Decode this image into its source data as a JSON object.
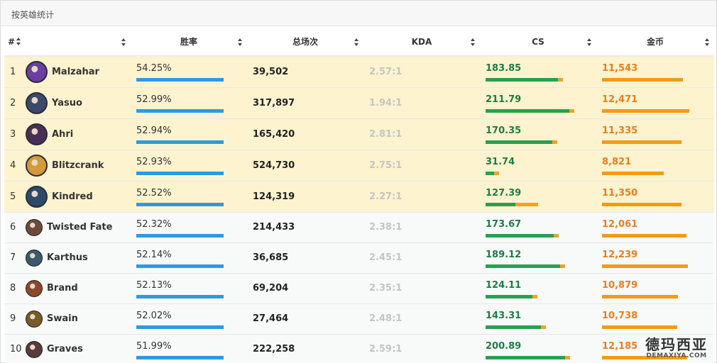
{
  "header": {
    "title": "按英雄统计"
  },
  "columns": [
    {
      "key": "rank",
      "label": "#"
    },
    {
      "key": "hero",
      "label": ""
    },
    {
      "key": "winrate",
      "label": "胜率"
    },
    {
      "key": "games",
      "label": "总场次"
    },
    {
      "key": "kda",
      "label": "KDA"
    },
    {
      "key": "cs",
      "label": "CS"
    },
    {
      "key": "gold",
      "label": "金币"
    }
  ],
  "rows": [
    {
      "rank": "1",
      "hero": "Malzahar",
      "winrate": "54.25%",
      "winrate_pct": 54.25,
      "games": "39,502",
      "kda": "2.57:1",
      "cs": "183.85",
      "cs_val": 183.85,
      "gold": "11,543",
      "gold_val": 11543,
      "highlight": true,
      "avatar_color": "#6a3fa0",
      "avatar_icon": "malzahar-avatar"
    },
    {
      "rank": "2",
      "hero": "Yasuo",
      "winrate": "52.99%",
      "winrate_pct": 52.99,
      "games": "317,897",
      "kda": "1.94:1",
      "cs": "211.79",
      "cs_val": 211.79,
      "gold": "12,471",
      "gold_val": 12471,
      "highlight": true,
      "avatar_color": "#3b4a6b",
      "avatar_icon": "yasuo-avatar"
    },
    {
      "rank": "3",
      "hero": "Ahri",
      "winrate": "52.94%",
      "winrate_pct": 52.94,
      "games": "165,420",
      "kda": "2.81:1",
      "cs": "170.35",
      "cs_val": 170.35,
      "gold": "11,335",
      "gold_val": 11335,
      "highlight": true,
      "avatar_color": "#4a2f55",
      "avatar_icon": "ahri-avatar"
    },
    {
      "rank": "4",
      "hero": "Blitzcrank",
      "winrate": "52.93%",
      "winrate_pct": 52.93,
      "games": "524,730",
      "kda": "2.75:1",
      "cs": "31.74",
      "cs_val": 31.74,
      "gold": "8,821",
      "gold_val": 8821,
      "highlight": true,
      "avatar_color": "#d49a3a",
      "avatar_icon": "blitzcrank-avatar"
    },
    {
      "rank": "5",
      "hero": "Kindred",
      "winrate": "52.52%",
      "winrate_pct": 52.52,
      "games": "124,319",
      "kda": "2.27:1",
      "cs": "127.39",
      "cs_val": 127.39,
      "gold": "11,350",
      "gold_val": 11350,
      "highlight": true,
      "avatar_color": "#2d4a6b",
      "avatar_icon": "kindred-avatar"
    },
    {
      "rank": "6",
      "hero": "Twisted Fate",
      "winrate": "52.32%",
      "winrate_pct": 52.32,
      "games": "214,433",
      "kda": "2.38:1",
      "cs": "173.67",
      "cs_val": 173.67,
      "gold": "12,061",
      "gold_val": 12061,
      "highlight": false,
      "avatar_color": "#6b4a3a",
      "avatar_icon": "twisted-fate-avatar"
    },
    {
      "rank": "7",
      "hero": "Karthus",
      "winrate": "52.14%",
      "winrate_pct": 52.14,
      "games": "36,685",
      "kda": "2.45:1",
      "cs": "189.12",
      "cs_val": 189.12,
      "gold": "12,239",
      "gold_val": 12239,
      "highlight": false,
      "avatar_color": "#3a5a6b",
      "avatar_icon": "karthus-avatar"
    },
    {
      "rank": "8",
      "hero": "Brand",
      "winrate": "52.13%",
      "winrate_pct": 52.13,
      "games": "69,204",
      "kda": "2.35:1",
      "cs": "124.11",
      "cs_val": 124.11,
      "gold": "10,879",
      "gold_val": 10879,
      "highlight": false,
      "avatar_color": "#8a4a2a",
      "avatar_icon": "brand-avatar"
    },
    {
      "rank": "9",
      "hero": "Swain",
      "winrate": "52.02%",
      "winrate_pct": 52.02,
      "games": "27,464",
      "kda": "2.48:1",
      "cs": "143.31",
      "cs_val": 143.31,
      "gold": "10,738",
      "gold_val": 10738,
      "highlight": false,
      "avatar_color": "#7a5a2a",
      "avatar_icon": "swain-avatar"
    },
    {
      "rank": "10",
      "hero": "Graves",
      "winrate": "51.99%",
      "winrate_pct": 51.99,
      "games": "222,258",
      "kda": "2.59:1",
      "cs": "200.89",
      "cs_val": 200.89,
      "gold": "12,185",
      "gold_val": 12185,
      "highlight": false,
      "avatar_color": "#5a3a3a",
      "avatar_icon": "graves-avatar"
    }
  ],
  "watermark": {
    "cn": "德玛西亚",
    "en": "DEMAXIYA.COM"
  },
  "colors": {
    "winrate_bar": "#2d9ae0",
    "cs_bar": "#27a14f",
    "cs_bar_accent": "#f0a229",
    "gold_bar": "#f29b14",
    "highlight_row": "#fdf3cf"
  }
}
